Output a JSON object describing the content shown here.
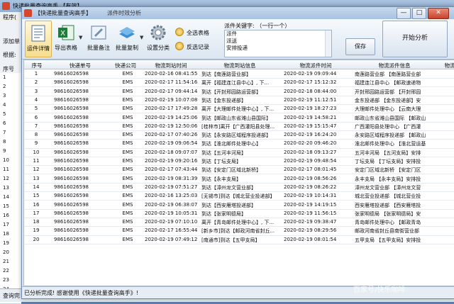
{
  "main_window": {
    "title": "快递批量查询高手 【有效】",
    "menu_label": "程序(",
    "side_labels": [
      "添加单",
      "根据:",
      "序号"
    ],
    "row_numbers": [
      "1",
      "2",
      "3",
      "4",
      "5",
      "6",
      "7",
      "8",
      "9",
      "10",
      "11",
      "12",
      "13",
      "14",
      "15",
      "16",
      "17",
      "18",
      "19",
      "20",
      "21",
      "22",
      "23",
      "24",
      "25"
    ],
    "status": "查询完"
  },
  "dialog": {
    "title": "【快递批量查询高手】",
    "subtitle": "派件时效分析",
    "window_buttons": [
      "—",
      "□",
      "✕"
    ]
  },
  "toolbar": {
    "buttons": [
      {
        "label": "运件详情",
        "icon": "list-icon"
      },
      {
        "label": "导出表格",
        "icon": "excel-icon"
      },
      {
        "label": "批量备注",
        "icon": "note-icon"
      },
      {
        "label": "批量复制",
        "icon": "copy-icon"
      },
      {
        "label": "设置分类",
        "icon": "gear-icon"
      }
    ],
    "select_all": "全选表格",
    "invert_select": "反选记录",
    "keyword_label": "派件关键字: （一行一个）",
    "keywords": [
      "派件",
      "派送",
      "安排投递"
    ],
    "save_label": "保存",
    "start_label": "开始分析"
  },
  "table": {
    "columns": [
      "序号",
      "快递单号",
      "快递公司",
      "物流到站时间",
      "物流到站信息",
      "物流派件时间",
      "物流派件信息",
      "物流"
    ],
    "rows": [
      [
        "1",
        "98616026598",
        "EMS",
        "2020-02-16 08:41:55",
        "到达【南莲路营业部】",
        "2020-02-19 09:09:44",
        "南莲路营业部 【南莲路营业部"
      ],
      [
        "2",
        "98616026598",
        "EMS",
        "2020-02-17 11:54:16",
        "离开【福建连江县中心】, 下...",
        "2020-02-17 15:12:32",
        "福建连江县中心 【邮政速递物"
      ],
      [
        "3",
        "98616026598",
        "EMS",
        "2020-02-17 09:44:14",
        "到达【开封邢园路运营部】",
        "2020-02-18 08:44:00",
        "开封邢园路运营部 【开封邢园"
      ],
      [
        "4",
        "98616026598",
        "EMS",
        "2020-02-19 10:07:08",
        "到达【金东投递部】",
        "2020-02-19 11:12:51",
        "金东投递部 【金东投递部】安"
      ],
      [
        "5",
        "98616026598",
        "EMS",
        "2020-02-17 17:49:28",
        "离开【大理邮件处理中心】, 下...",
        "2020-02-19 18:27:23",
        "大理邮件处理中心 【云南大理"
      ],
      [
        "6",
        "98616026598",
        "EMS",
        "2020-02-19 14:25:06",
        "到达【邮政山东省潍山县国际】",
        "2020-02-19 14:58:21",
        "邮政山东省潍山县国际 【邮政山"
      ],
      [
        "7",
        "98616026598",
        "EMS",
        "2020-02-19 12:50:06",
        "[桂林市]离开【广西灌阳县处理...",
        "2020-02-19 15:15:47",
        "广西灌阳县处理中心 【广西灌"
      ],
      [
        "8",
        "98616026598",
        "EMS",
        "2020-02-17 07:40:26",
        "到达【永安路区域程序投递部】",
        "2020-02-19 16:24:20",
        "永安路区域程序投递部 【邮政山"
      ],
      [
        "9",
        "98616026598",
        "EMS",
        "2020-02-19 09:06:54",
        "到达【淮北邮件处理中心】",
        "2020-02-20 09:46:20",
        "淮北邮件处理中心 【淮北营运基"
      ],
      [
        "10",
        "98616026598",
        "EMS",
        "2020-02-18 09:07:07",
        "到达【五河丰河局】",
        "2020-02-18 09:13:27",
        "五河丰河局 【五河支局】安排"
      ],
      [
        "11",
        "98616026598",
        "EMS",
        "2020-02-19 09:20:16",
        "到达【丁坛支局】",
        "2020-02-19 09:48:54",
        "丁坛支局 【丁坛支局】安排投"
      ],
      [
        "12",
        "98616026598",
        "EMS",
        "2020-02-17 07:43:44",
        "到达【安定门区域北新桥】",
        "2020-02-17 08:01:45",
        "安定门区域北新桥 【安定门区"
      ],
      [
        "13",
        "98616026598",
        "EMS",
        "2020-02-19 08:31:39",
        "到达【永丰支局】",
        "2020-02-19 08:56:26",
        "永丰支局 【永丰支局】安排投"
      ],
      [
        "14",
        "98616026598",
        "EMS",
        "2020-02-19 07:51:27",
        "到达【漳州龙文营业部】",
        "2020-02-19 08:26:22",
        "漳州龙文营业部 【漳州龙文营"
      ],
      [
        "15",
        "98616026598",
        "EMS",
        "2020-02-16 13:25:03",
        "[无锡市]到达【城北营业投递部】",
        "2020-02-19 10:14:31",
        "城北营业投递部 【城北营业投"
      ],
      [
        "16",
        "98616026598",
        "EMS",
        "2020-02-19 06:38:07",
        "到达【西安雁塔投递部】",
        "2020-02-19 14:19:15",
        "西安雁塔投递部 【西安雁塔投"
      ],
      [
        "17",
        "98616026598",
        "EMS",
        "2020-02-19 10:05:31",
        "到达【张家明德局】",
        "2020-02-19 11:56:15",
        "张家明德局 【张家明德局】安"
      ],
      [
        "18",
        "98616026598",
        "EMS",
        "2020-02-19 07:10:10",
        "离开【青岛邮件处理中心】, 下...",
        "2020-02-19 09:38:47",
        "青岛邮件处理中心 【邮政青岛"
      ],
      [
        "19",
        "98616026598",
        "EMS",
        "2020-02-17 16:55:44",
        "[新乡市]到达【邮政河南省封丘...",
        "2020-02-19 08:29:56",
        "邮政河南省封丘县南街营业部"
      ],
      [
        "20",
        "98616026598",
        "EMS",
        "2020-02-19 07:49:12",
        "[南通市]到达【五甲支局】",
        "2020-02-19 08:01:54",
        "五甲支局 【五甲支局】安排投"
      ]
    ]
  },
  "status_text": "已分析完成! 感谢使用《快递批量查询高手》!",
  "watermark": "百家号/快乐咖啡"
}
